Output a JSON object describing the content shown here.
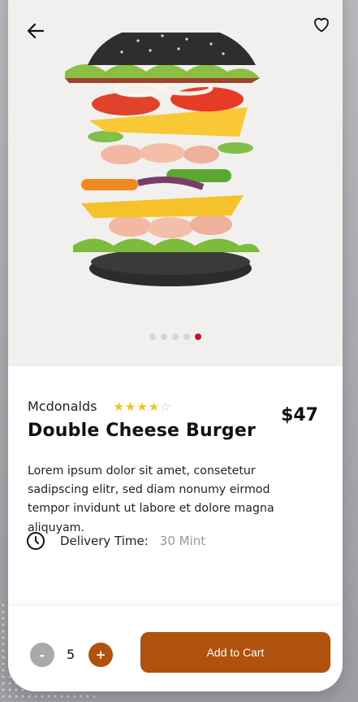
{
  "colors": {
    "accent": "#b0520e",
    "star": "#f3c21b",
    "active_dot": "#c8102e",
    "muted": "#9a9a9a"
  },
  "header": {
    "back_icon": "arrow-left-icon",
    "favorite_icon": "heart-outline-icon"
  },
  "carousel": {
    "total": 5,
    "active_index": 4
  },
  "product": {
    "brand": "Mcdonalds",
    "rating": 4,
    "rating_max": 5,
    "name": "Double Cheese Burger",
    "price": "$47",
    "description": "Lorem ipsum dolor sit amet, consetetur sadipscing elitr, sed diam nonumy eirmod tempor invidunt ut labore et dolore magna aliquyam.",
    "delivery_label": "Delivery Time:",
    "delivery_value": "30 Mint"
  },
  "cart": {
    "minus_label": "-",
    "quantity": "5",
    "plus_label": "+",
    "button_label": "Add to Cart"
  }
}
